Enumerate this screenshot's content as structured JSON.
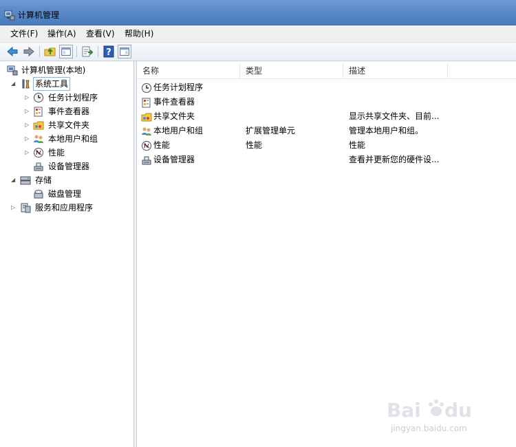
{
  "window": {
    "title": "计算机管理"
  },
  "menu": {
    "items": [
      {
        "label": "文件(F)"
      },
      {
        "label": "操作(A)"
      },
      {
        "label": "查看(V)"
      },
      {
        "label": "帮助(H)"
      }
    ]
  },
  "toolbar": {
    "buttons": [
      {
        "icon": "back-arrow-icon"
      },
      {
        "icon": "forward-arrow-icon"
      },
      {
        "icon": "up-folder-icon"
      },
      {
        "icon": "show-hide-console-tree-icon"
      },
      {
        "icon": "export-list-icon"
      },
      {
        "icon": "help-icon"
      },
      {
        "icon": "show-hide-action-pane-icon"
      }
    ]
  },
  "tree": {
    "root": {
      "label": "计算机管理(本地)",
      "icon": "computer-management-icon"
    },
    "items": [
      {
        "label": "系统工具",
        "icon": "system-tools-icon",
        "expanded": true,
        "selected": true
      },
      {
        "label": "任务计划程序",
        "icon": "task-scheduler-icon"
      },
      {
        "label": "事件查看器",
        "icon": "event-viewer-icon"
      },
      {
        "label": "共享文件夹",
        "icon": "shared-folders-icon"
      },
      {
        "label": "本地用户和组",
        "icon": "local-users-groups-icon"
      },
      {
        "label": "性能",
        "icon": "performance-icon"
      },
      {
        "label": "设备管理器",
        "icon": "device-manager-icon"
      },
      {
        "label": "存储",
        "icon": "storage-icon",
        "expanded": true
      },
      {
        "label": "磁盘管理",
        "icon": "disk-management-icon"
      },
      {
        "label": "服务和应用程序",
        "icon": "services-applications-icon"
      }
    ]
  },
  "list": {
    "columns": [
      {
        "label": "名称"
      },
      {
        "label": "类型"
      },
      {
        "label": "描述"
      }
    ],
    "rows": [
      {
        "name": "任务计划程序",
        "type": "",
        "desc": "",
        "icon": "task-scheduler-icon"
      },
      {
        "name": "事件查看器",
        "type": "",
        "desc": "",
        "icon": "event-viewer-icon"
      },
      {
        "name": "共享文件夹",
        "type": "",
        "desc": "显示共享文件夹、目前...",
        "icon": "shared-folders-icon"
      },
      {
        "name": "本地用户和组",
        "type": "扩展管理单元",
        "desc": "管理本地用户和组。",
        "icon": "local-users-groups-icon"
      },
      {
        "name": "性能",
        "type": "性能",
        "desc": "性能",
        "icon": "performance-icon"
      },
      {
        "name": "设备管理器",
        "type": "",
        "desc": "查看并更新您的硬件设...",
        "icon": "device-manager-icon"
      }
    ]
  },
  "watermark": {
    "text": "jingyan.baidu.com"
  },
  "colors": {
    "titlebar": "#5b8bc9",
    "selection_border": "#8bb3e0",
    "toolbar_bg": "#e9eef5"
  }
}
